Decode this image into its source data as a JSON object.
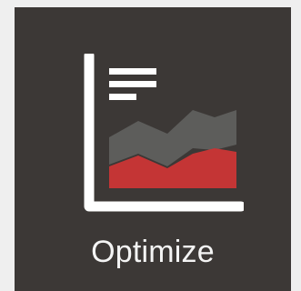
{
  "tile": {
    "label": "Optimize",
    "icon": "area-chart-report-icon"
  },
  "colors": {
    "tile_background": "#3c3836",
    "page_background": "#efefef",
    "icon_white": "#ffffff",
    "chart_gray": "#5d5d5b",
    "chart_red": "#c43535",
    "label_text": "#f4f4f4"
  }
}
